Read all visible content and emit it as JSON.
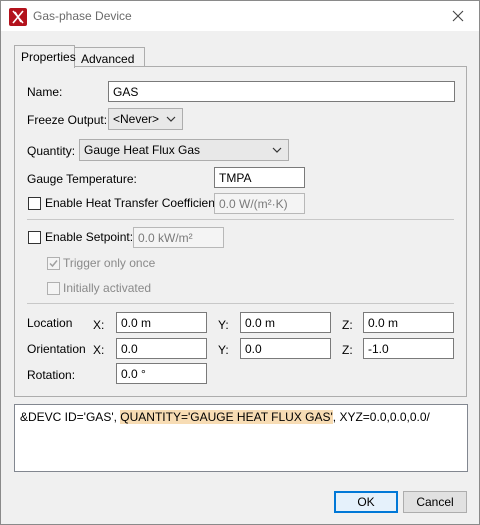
{
  "window": {
    "title": "Gas-phase Device",
    "app_icon": "fds-app-icon",
    "close_icon": "close-icon"
  },
  "tabs": [
    {
      "label": "Properties",
      "active": true
    },
    {
      "label": "Advanced",
      "active": false
    }
  ],
  "properties": {
    "name": {
      "label": "Name:",
      "value": "GAS"
    },
    "freeze_output": {
      "label": "Freeze Output:",
      "value": "<Never>"
    },
    "quantity": {
      "label": "Quantity:",
      "value": "Gauge Heat Flux Gas"
    },
    "gauge_temperature": {
      "label": "Gauge Temperature:",
      "value": "TMPA"
    },
    "heat_transfer": {
      "label": "Enable Heat Transfer Coefficient:",
      "checked": false,
      "value": "0.0 W/(m²·K)"
    },
    "setpoint": {
      "label": "Enable Setpoint:",
      "checked": false,
      "value": "0.0 kW/m²"
    },
    "trigger_once": {
      "label": "Trigger only once",
      "checked": true,
      "enabled": false
    },
    "initially_activated": {
      "label": "Initially activated",
      "checked": false,
      "enabled": false
    },
    "location": {
      "label": "Location",
      "x_label": "X:",
      "x": "0.0 m",
      "y_label": "Y:",
      "y": "0.0 m",
      "z_label": "Z:",
      "z": "0.0 m"
    },
    "orientation": {
      "label": "Orientation",
      "x_label": "X:",
      "x": "0.0",
      "y_label": "Y:",
      "y": "0.0",
      "z_label": "Z:",
      "z": "-1.0"
    },
    "rotation": {
      "label": "Rotation:",
      "value": "0.0 °"
    }
  },
  "fds_text": {
    "before": "&DEVC ID='GAS', ",
    "highlighted": "QUANTITY='GAUGE HEAT FLUX GAS'",
    "after": ", XYZ=0.0,0.0,0.0/"
  },
  "buttons": {
    "ok": "OK",
    "cancel": "Cancel"
  },
  "colors": {
    "app_icon_bg": "#b3121c",
    "highlight": "#f7dcb4",
    "default_button_border": "#0078d7"
  }
}
